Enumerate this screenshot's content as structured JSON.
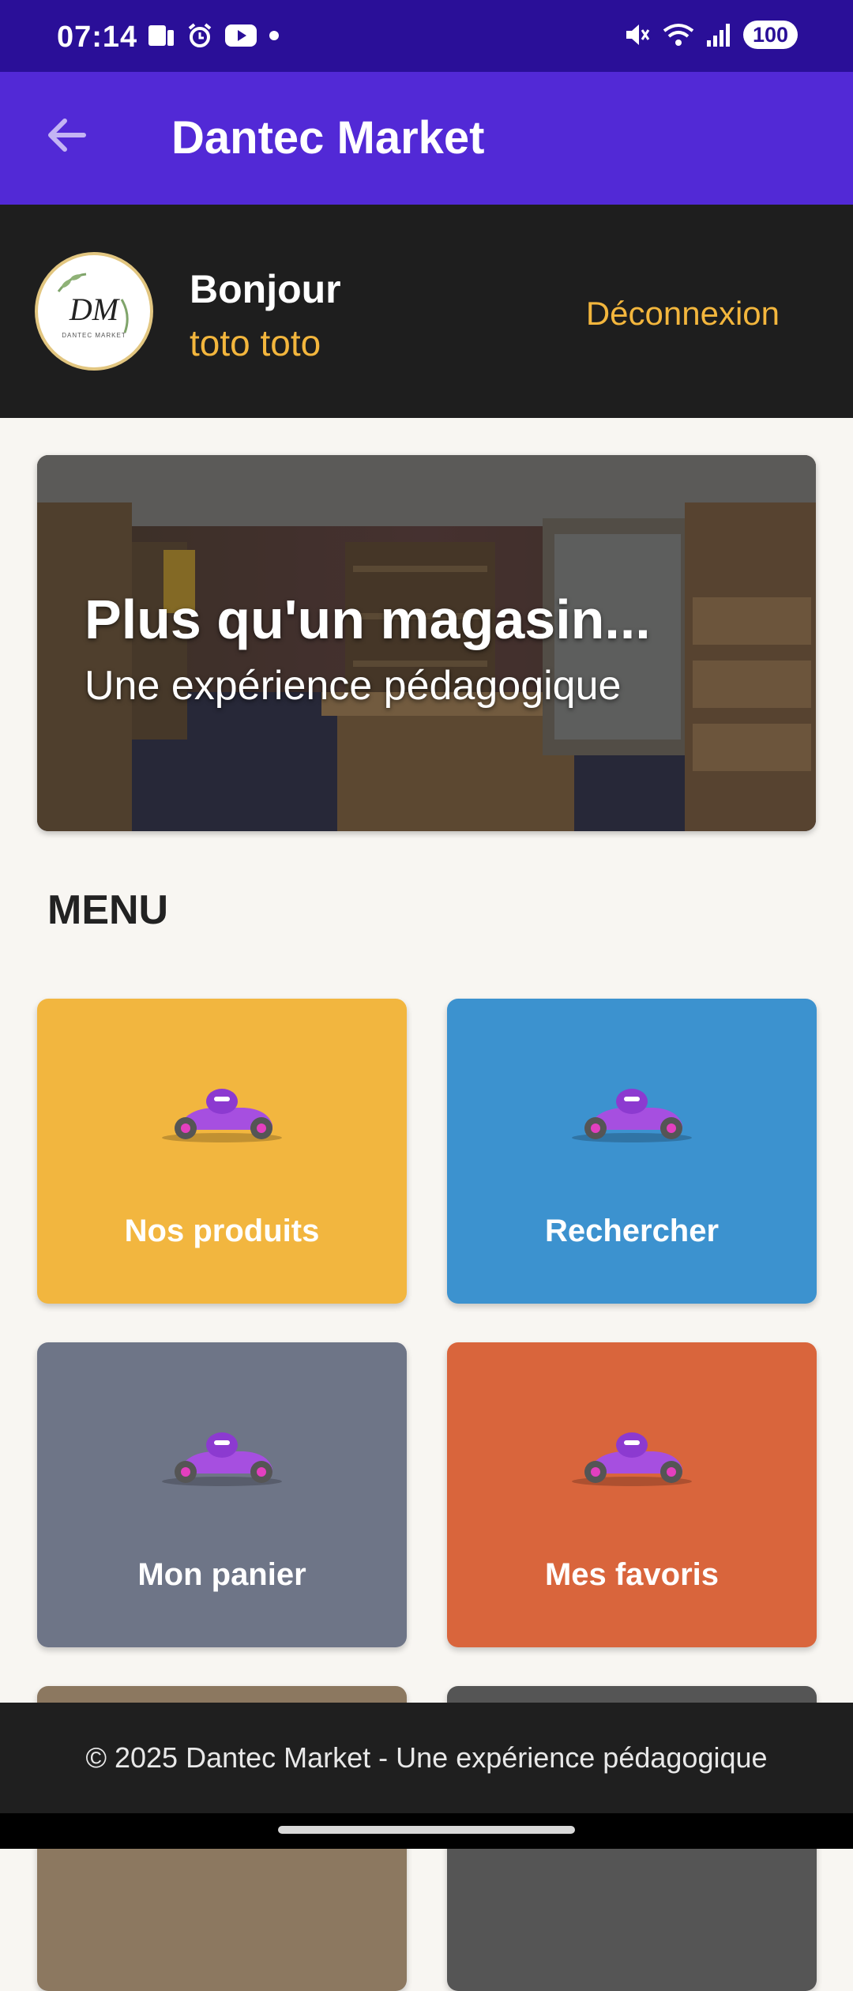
{
  "status_bar": {
    "time": "07:14",
    "battery": "100",
    "left_icons": [
      "device-icon",
      "alarm-icon",
      "youtube-icon",
      "dot-icon"
    ],
    "right_icons": [
      "mute-icon",
      "wifi-icon",
      "signal-icon"
    ]
  },
  "appbar": {
    "title": "Dantec Market",
    "back_icon": "arrow-left-icon",
    "color": "#5229d6"
  },
  "user": {
    "greeting": "Bonjour",
    "name": "toto toto",
    "logout_label": "Déconnexion",
    "avatar_monogram": "DM",
    "avatar_caption": "DANTEC MARKET"
  },
  "banner": {
    "title": "Plus qu'un magasin...",
    "subtitle": "Une expérience pédagogique"
  },
  "menu": {
    "title": "MENU",
    "tiles": [
      {
        "label": "Nos produits",
        "color": "#f2b63f"
      },
      {
        "label": "Rechercher",
        "color": "#3c92cf"
      },
      {
        "label": "Mon panier",
        "color": "#6e7587"
      },
      {
        "label": "Mes favoris",
        "color": "#d9653c"
      }
    ],
    "partial_tile_colors": [
      "#8c7860",
      "#555555"
    ]
  },
  "footer": {
    "text": "© 2025 Dantec Market - Une expérience pédagogique"
  }
}
